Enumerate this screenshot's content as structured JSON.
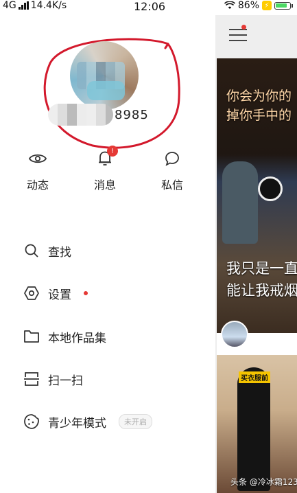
{
  "status_bar": {
    "network": "4G",
    "speed": "14.4K/s",
    "time": "12:06",
    "battery_percent": "86%"
  },
  "profile": {
    "user_id_suffix": "8985"
  },
  "quick_actions": [
    {
      "label": "动态",
      "icon": "eye-icon"
    },
    {
      "label": "消息",
      "icon": "bell-icon",
      "badge": "!"
    },
    {
      "label": "私信",
      "icon": "chat-bubble-icon"
    }
  ],
  "menu": [
    {
      "label": "查找",
      "icon": "search-icon"
    },
    {
      "label": "设置",
      "icon": "settings-icon",
      "red_dot": true
    },
    {
      "label": "本地作品集",
      "icon": "folder-icon"
    },
    {
      "label": "扫一扫",
      "icon": "scan-icon"
    },
    {
      "label": "青少年模式",
      "icon": "cookie-icon",
      "status": "未开启"
    }
  ],
  "feed": {
    "card1_lines": [
      "你会为你的",
      "掉你手中的",
      "我只是一直",
      "能让我戒烟"
    ],
    "card2_tag": "买衣服前",
    "watermark": "头条 @冷冰霜123"
  },
  "colors": {
    "accent_red": "#e53935",
    "battery_green": "#4cd964",
    "annotation_red": "#d3192c"
  }
}
